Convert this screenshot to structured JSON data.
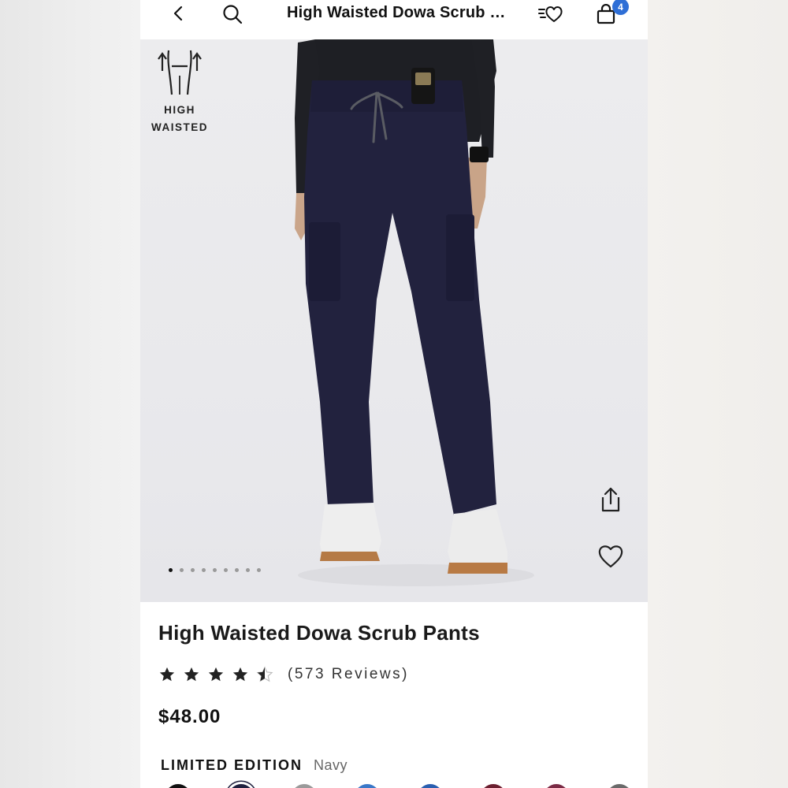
{
  "navbar": {
    "title": "High Waisted Dowa Scrub Pants",
    "cart_count": "4",
    "icons": [
      "chevron-left-icon",
      "search-icon",
      "wishlist-list-icon",
      "cart-icon"
    ]
  },
  "hero": {
    "badge_line1": "HIGH",
    "badge_line2": "WAISTED",
    "image_count": 9,
    "active_image": 1
  },
  "product": {
    "title": "High Waisted Dowa Scrub Pants",
    "rating": 4.5,
    "reviews": "(573 Reviews)",
    "price": "$48.00",
    "edition_label": "LIMITED EDITION",
    "color_name": "Navy"
  },
  "colors": {
    "accent": "#2f6fd6",
    "navy": "#20213f",
    "text": "#111111"
  },
  "swatch_colors": [
    "#111111",
    "#20213f",
    "#9a9a9a",
    "#3a78c8",
    "#2a5fb0",
    "#6b1f2f",
    "#7a2a45",
    "#6a6a6a"
  ]
}
